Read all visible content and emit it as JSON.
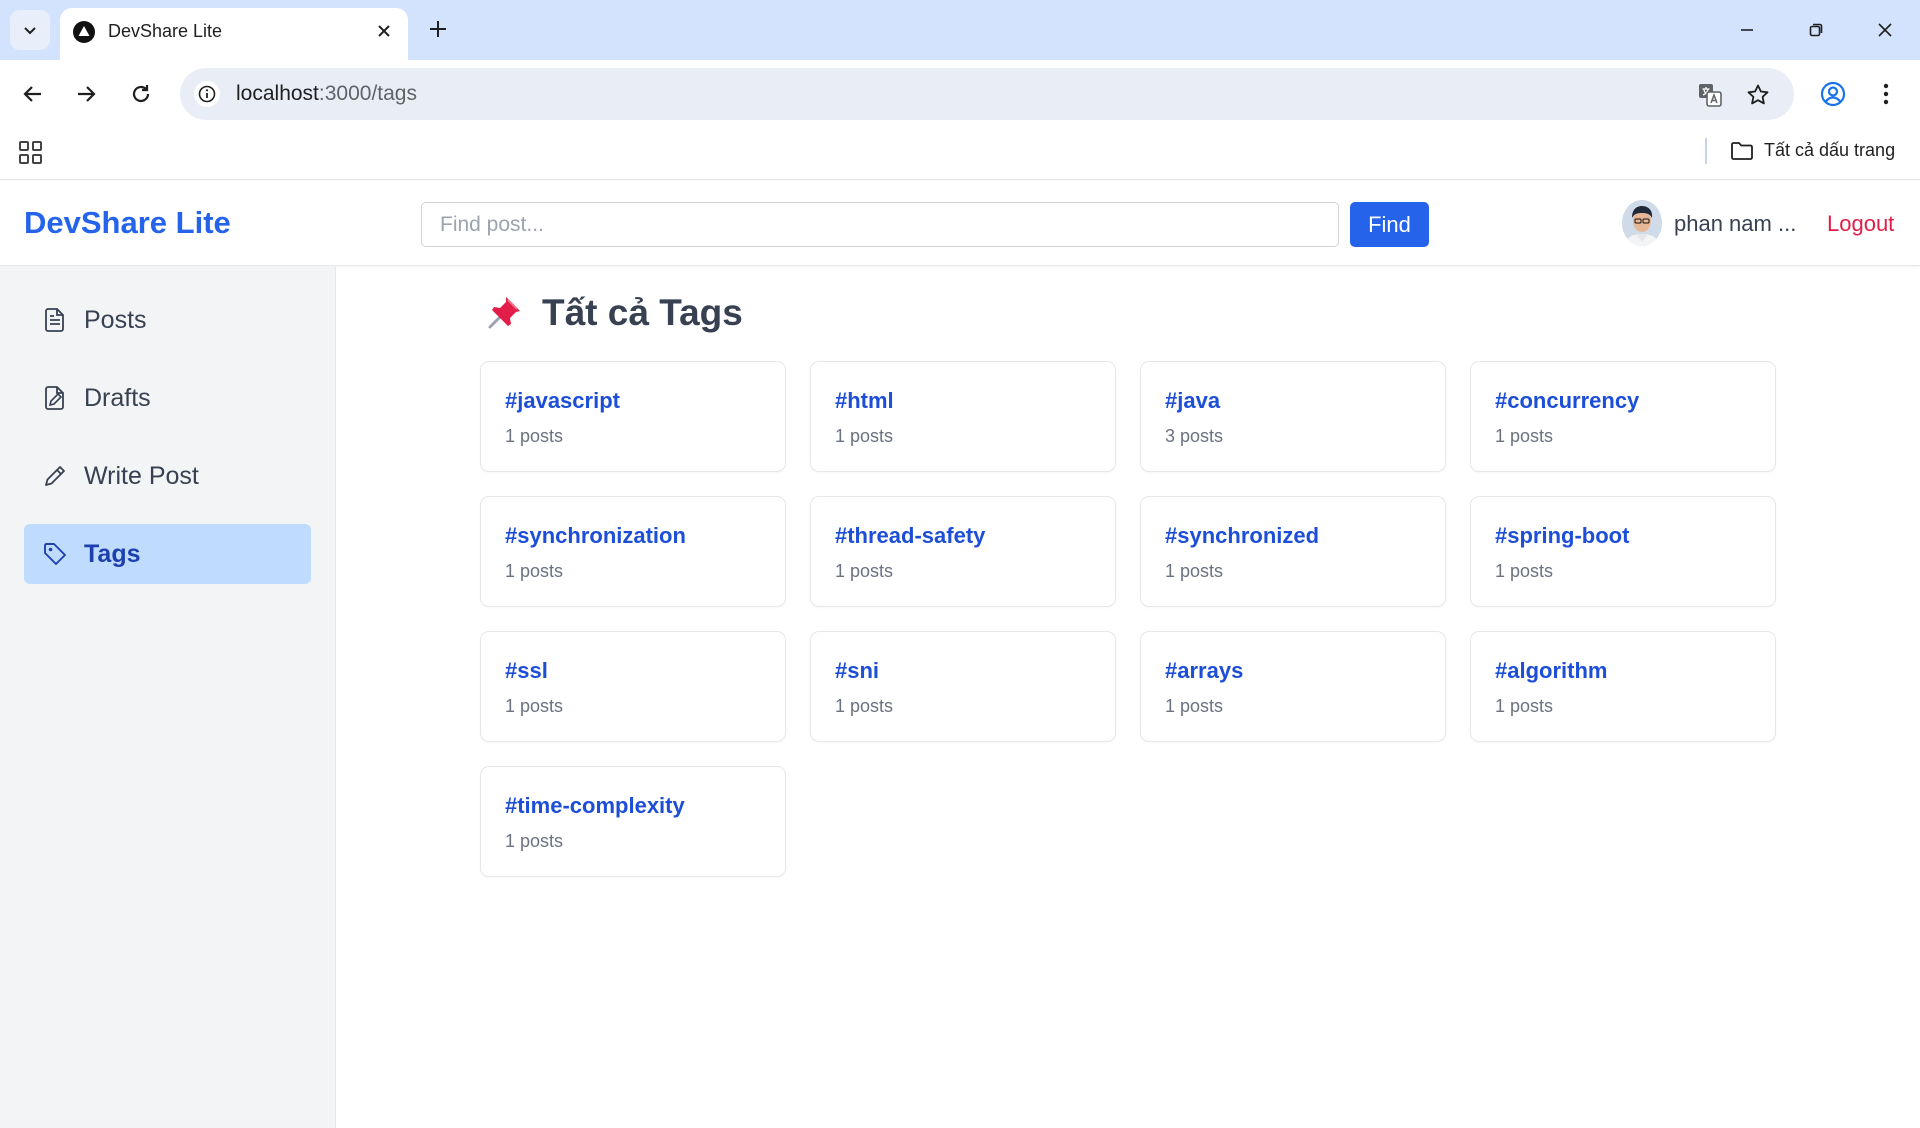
{
  "browser": {
    "tab_title": "DevShare Lite",
    "url_host": "localhost",
    "url_path": ":3000/tags",
    "bookmarks_folder": "Tất cả dấu trang"
  },
  "header": {
    "brand": "DevShare Lite",
    "search_placeholder": "Find post...",
    "find_label": "Find",
    "user_name": "phan nam ...",
    "logout_label": "Logout"
  },
  "sidebar": {
    "items": [
      {
        "label": "Posts",
        "icon": "document-icon",
        "active": false
      },
      {
        "label": "Drafts",
        "icon": "draft-icon",
        "active": false
      },
      {
        "label": "Write Post",
        "icon": "pencil-icon",
        "active": false
      },
      {
        "label": "Tags",
        "icon": "tag-icon",
        "active": true
      }
    ]
  },
  "main": {
    "title": "Tất cả Tags",
    "tags": [
      {
        "name": "#javascript",
        "count": "1 posts"
      },
      {
        "name": "#html",
        "count": "1 posts"
      },
      {
        "name": "#java",
        "count": "3 posts"
      },
      {
        "name": "#concurrency",
        "count": "1 posts"
      },
      {
        "name": "#synchronization",
        "count": "1 posts"
      },
      {
        "name": "#thread-safety",
        "count": "1 posts"
      },
      {
        "name": "#synchronized",
        "count": "1 posts"
      },
      {
        "name": "#spring-boot",
        "count": "1 posts"
      },
      {
        "name": "#ssl",
        "count": "1 posts"
      },
      {
        "name": "#sni",
        "count": "1 posts"
      },
      {
        "name": "#arrays",
        "count": "1 posts"
      },
      {
        "name": "#algorithm",
        "count": "1 posts"
      },
      {
        "name": "#time-complexity",
        "count": "1 posts"
      }
    ]
  },
  "colors": {
    "brand": "#2563eb",
    "tag_link": "#1d4ed8",
    "logout": "#e11d48",
    "active_item_bg": "#bfdbfe"
  }
}
